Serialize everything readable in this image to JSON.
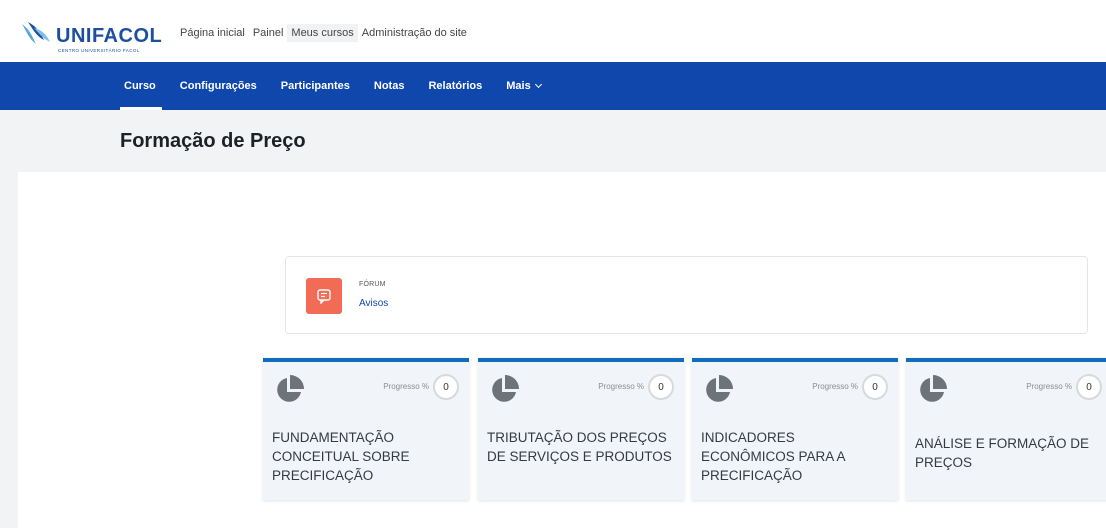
{
  "brand": {
    "name": "UNIFACOL",
    "subtitle": "CENTRO UNIVERSITÁRIO FACOL",
    "color": "#1d4fa0"
  },
  "topnav": [
    {
      "label": "Página inicial"
    },
    {
      "label": "Painel"
    },
    {
      "label": "Meus cursos"
    },
    {
      "label": "Administração do site"
    }
  ],
  "secondary_nav": [
    {
      "label": "Curso"
    },
    {
      "label": "Configurações"
    },
    {
      "label": "Participantes"
    },
    {
      "label": "Notas"
    },
    {
      "label": "Relatórios"
    },
    {
      "label": "Mais"
    }
  ],
  "accent_color": "#0f47ad",
  "page": {
    "title": "Formação de Preço"
  },
  "forum": {
    "type": "FÓRUM",
    "name": "Avisos",
    "icon": "forum-icon",
    "icon_color": "#f26b55"
  },
  "sections": [
    {
      "title": "FUNDAMENTAÇÃO CONCEITUAL SOBRE PRECIFICAÇÃO",
      "progress_label": "Progresso %",
      "progress": "0"
    },
    {
      "title": "TRIBUTAÇÃO DOS PREÇOS DE SERVIÇOS E PRODUTOS",
      "progress_label": "Progresso %",
      "progress": "0"
    },
    {
      "title": "INDICADORES ECONÔMICOS PARA A PRECIFICAÇÃO",
      "progress_label": "Progresso %",
      "progress": "0"
    },
    {
      "title": "ANÁLISE E FORMAÇÃO DE PREÇOS",
      "progress_label": "Progresso %",
      "progress": "0"
    }
  ]
}
